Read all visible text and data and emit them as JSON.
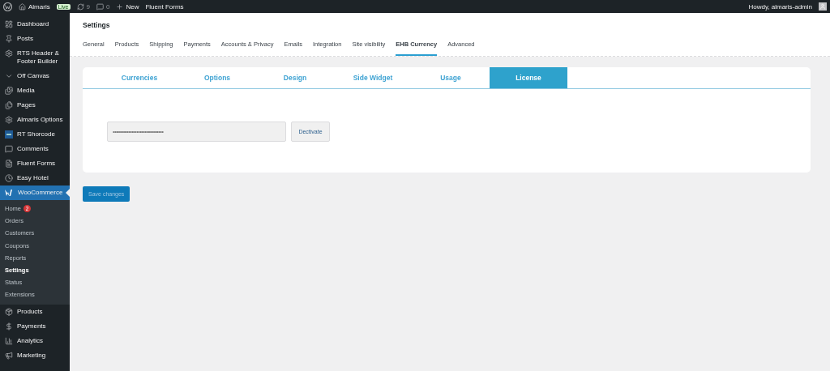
{
  "admin_bar": {
    "site_name": "Almaris",
    "live_badge": "Live",
    "updates_count": "9",
    "comments_count": "0",
    "new_label": "New",
    "fluent_forms": "Fluent Forms",
    "greeting": "Howdy, almaris-admin"
  },
  "sidebar": {
    "items": [
      {
        "label": "Dashboard",
        "current": false
      },
      {
        "label": "Posts",
        "current": false
      },
      {
        "label": "RTS Header & Footer Builder",
        "current": false
      },
      {
        "label": "Off Canvas",
        "current": false
      },
      {
        "label": "Media",
        "current": false
      },
      {
        "label": "Pages",
        "current": false
      },
      {
        "label": "Almaris Options",
        "current": false
      },
      {
        "label": "RT Shorcode",
        "current": false
      },
      {
        "label": "Comments",
        "current": false
      },
      {
        "label": "Fluent Forms",
        "current": false
      },
      {
        "label": "Easy Hotel",
        "current": false
      },
      {
        "label": "WooCommerce",
        "current": true,
        "children": [
          {
            "label": "Home",
            "badge": "2",
            "selected": false
          },
          {
            "label": "Orders",
            "selected": false
          },
          {
            "label": "Customers",
            "selected": false
          },
          {
            "label": "Coupons",
            "selected": false
          },
          {
            "label": "Reports",
            "selected": false
          },
          {
            "label": "Settings",
            "selected": true
          },
          {
            "label": "Status",
            "selected": false
          },
          {
            "label": "Extensions",
            "selected": false
          }
        ]
      },
      {
        "label": "Products",
        "current": false
      },
      {
        "label": "Payments",
        "current": false
      },
      {
        "label": "Analytics",
        "current": false
      },
      {
        "label": "Marketing",
        "current": false
      }
    ]
  },
  "page_title": "Settings",
  "settings_tabs": [
    {
      "label": "General",
      "selected": false
    },
    {
      "label": "Products",
      "selected": false
    },
    {
      "label": "Shipping",
      "selected": false
    },
    {
      "label": "Payments",
      "selected": false
    },
    {
      "label": "Accounts & Privacy",
      "selected": false
    },
    {
      "label": "Emails",
      "selected": false
    },
    {
      "label": "Integration",
      "selected": false
    },
    {
      "label": "Site visibility",
      "selected": false
    },
    {
      "label": "EHB Currency",
      "selected": true
    },
    {
      "label": "Advanced",
      "selected": false
    }
  ],
  "plugin_tabs": [
    {
      "label": "Currencies",
      "selected": false
    },
    {
      "label": "Options",
      "selected": false
    },
    {
      "label": "Design",
      "selected": false
    },
    {
      "label": "Side Widget",
      "selected": false
    },
    {
      "label": "Usage",
      "selected": false
    },
    {
      "label": "License",
      "selected": true
    }
  ],
  "license": {
    "key_value": "••••••••••••••••••••••••••••••••",
    "deactivate_button": "Dectivate"
  },
  "save_button": "Save changes"
}
